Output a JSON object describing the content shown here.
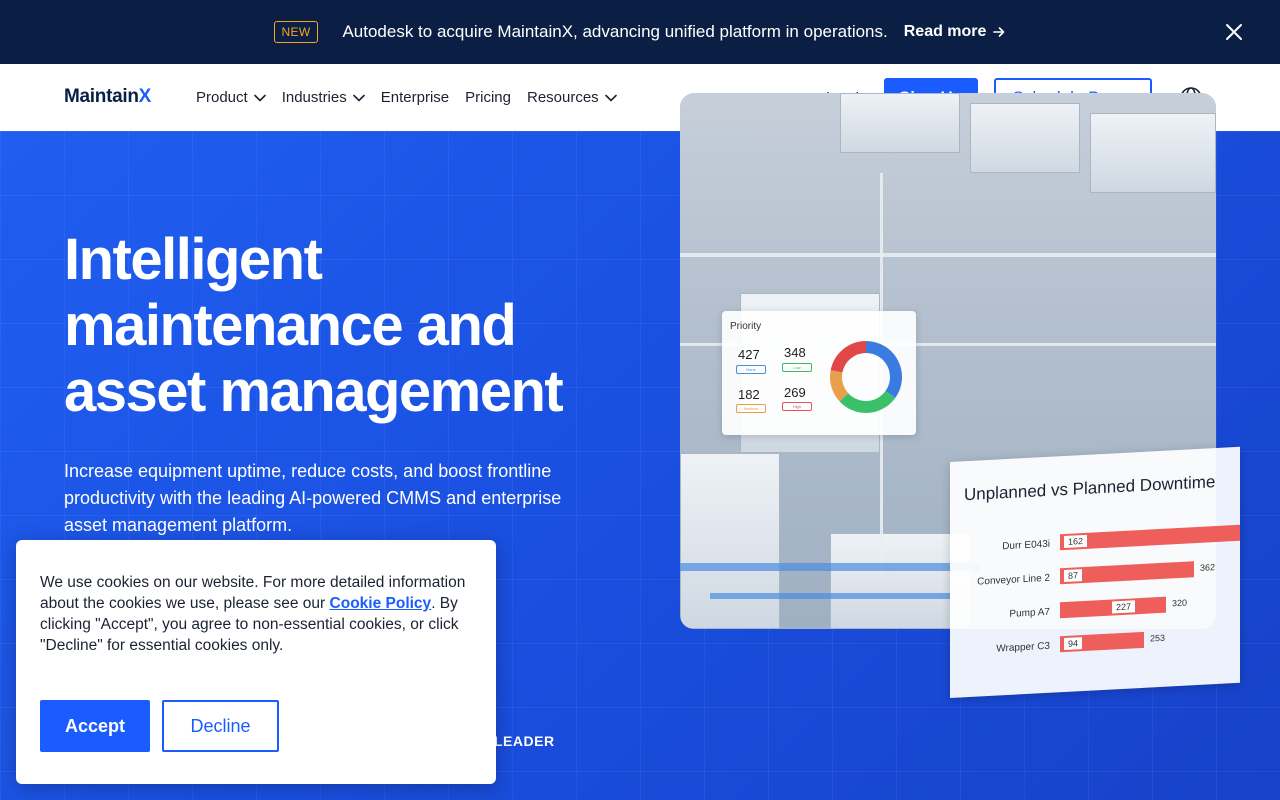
{
  "announcement": {
    "badge": "NEW",
    "message": "Autodesk to acquire MaintainX, advancing unified platform in operations.",
    "read_more": "Read more"
  },
  "nav": {
    "logo_main": "Maintain",
    "logo_x": "X",
    "items": [
      {
        "label": "Product",
        "dropdown": true
      },
      {
        "label": "Industries",
        "dropdown": true
      },
      {
        "label": "Enterprise",
        "dropdown": false
      },
      {
        "label": "Pricing",
        "dropdown": false
      },
      {
        "label": "Resources",
        "dropdown": true
      }
    ],
    "login": "Log In",
    "signup": "Sign Up",
    "demo": "Schedule Demo"
  },
  "hero": {
    "headline": "Intelligent maintenance and asset management",
    "subhead": "Increase equipment uptime, reduce costs, and boost frontline productivity with the leading AI-powered CMMS and enterprise asset management platform.",
    "leader_fragment": "LEADER"
  },
  "priority_card": {
    "title": "Priority",
    "entries": [
      {
        "value": "427",
        "tag": "None",
        "color": "#4a90d9"
      },
      {
        "value": "348",
        "tag": "Low",
        "color": "#3bb86a"
      },
      {
        "value": "182",
        "tag": "Medium",
        "color": "#e8a04a"
      },
      {
        "value": "269",
        "tag": "High",
        "color": "#e05555"
      }
    ],
    "donut": [
      {
        "value": 427,
        "color": "#3a7be0"
      },
      {
        "value": 348,
        "color": "#3bc06a"
      },
      {
        "value": 182,
        "color": "#e8a04a"
      },
      {
        "value": 269,
        "color": "#e04848"
      }
    ]
  },
  "downtime_card": {
    "title": "Unplanned vs Planned Downtime",
    "rows": [
      {
        "label": "Durr E043i",
        "inner": "162",
        "outer": ""
      },
      {
        "label": "Conveyor Line 2",
        "inner": "87",
        "outer": "362"
      },
      {
        "label": "Pump A7",
        "inner": "227",
        "outer": "320"
      },
      {
        "label": "Wrapper C3",
        "inner": "94",
        "outer": "253"
      }
    ]
  },
  "cookie": {
    "text_before": "We use cookies on our website. For more detailed information about the cookies we use, please see our ",
    "link": "Cookie Policy",
    "text_after": ". By clicking \"Accept\", you agree to non-essential cookies, or click \"Decline\" for essential cookies only.",
    "accept": "Accept",
    "decline": "Decline"
  },
  "colors": {
    "brand_blue": "#1a5cff",
    "navy": "#0b1f45",
    "badge_orange": "#f5a524"
  }
}
